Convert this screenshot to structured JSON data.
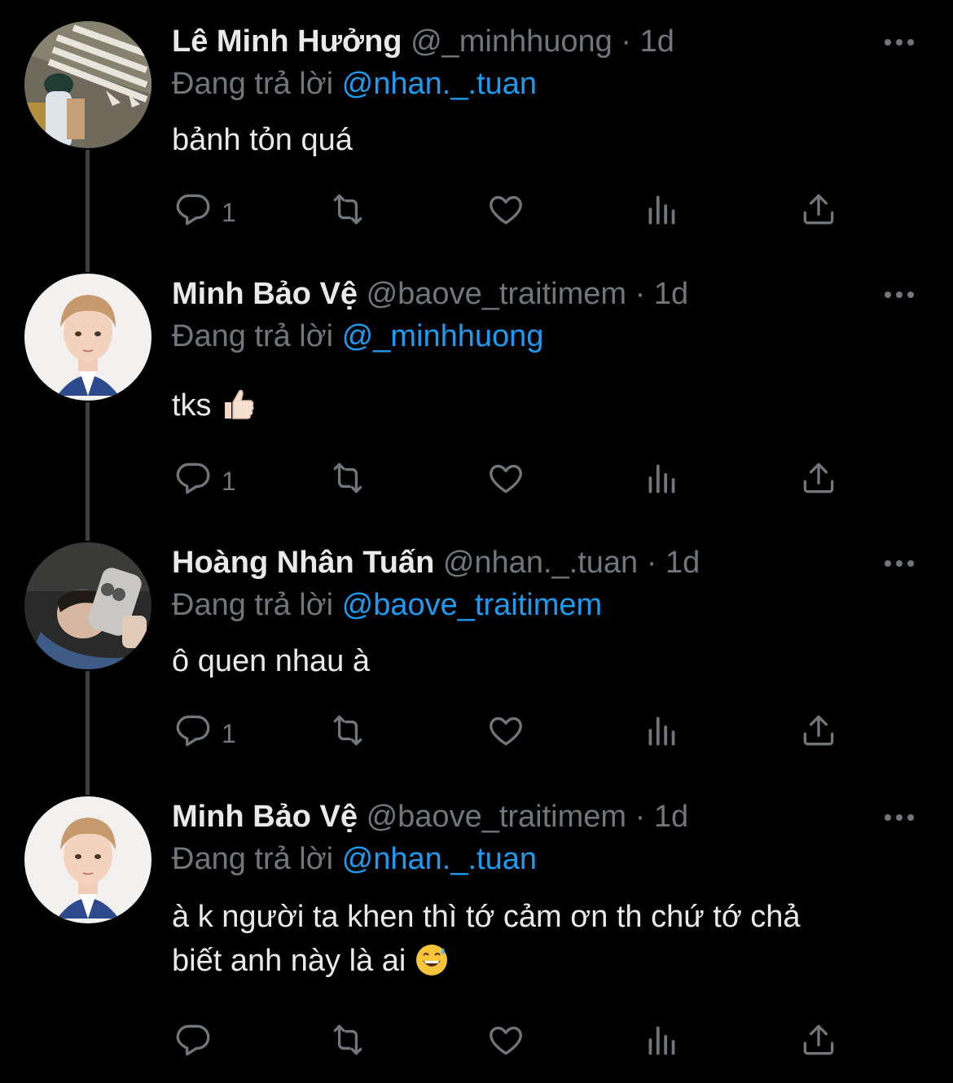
{
  "tweets": [
    {
      "name": "Lê Minh Hưởng",
      "handle": "@_minhhuong",
      "time": "· 1d",
      "replying_prefix": "Đang trả lời",
      "replying_to": "@nhan._.tuan",
      "text": "bảnh tỏn quá",
      "reply_count": "1"
    },
    {
      "name": "Minh Bảo Vệ",
      "handle": "@baove_traitimem",
      "time": "· 1d",
      "replying_prefix": "Đang trả lời",
      "replying_to": "@_minhhuong",
      "text": "tks",
      "emoji": "thumbs-up",
      "reply_count": "1"
    },
    {
      "name": "Hoàng Nhân Tuấn",
      "handle": "@nhan._.tuan",
      "time": "· 1d",
      "replying_prefix": "Đang trả lời",
      "replying_to": "@baove_traitimem",
      "text": "ô quen nhau à",
      "reply_count": "1"
    },
    {
      "name": "Minh Bảo Vệ",
      "handle": "@baove_traitimem",
      "time": "· 1d",
      "replying_prefix": "Đang trả lời",
      "replying_to": "@nhan._.tuan",
      "text_line1": "à k người ta khen thì tớ cảm ơn th chứ tớ chả",
      "text_line2": "biết anh này là ai",
      "emoji": "grinning-sweat",
      "reply_count": ""
    }
  ],
  "colors": {
    "background": "#000000",
    "text": "#e7e9ea",
    "secondary": "#71767b",
    "mention": "#1d9bf0",
    "thread_line": "#3e4144"
  },
  "icons": [
    "reply-icon",
    "retweet-icon",
    "like-icon",
    "views-icon",
    "share-icon",
    "more-icon"
  ]
}
